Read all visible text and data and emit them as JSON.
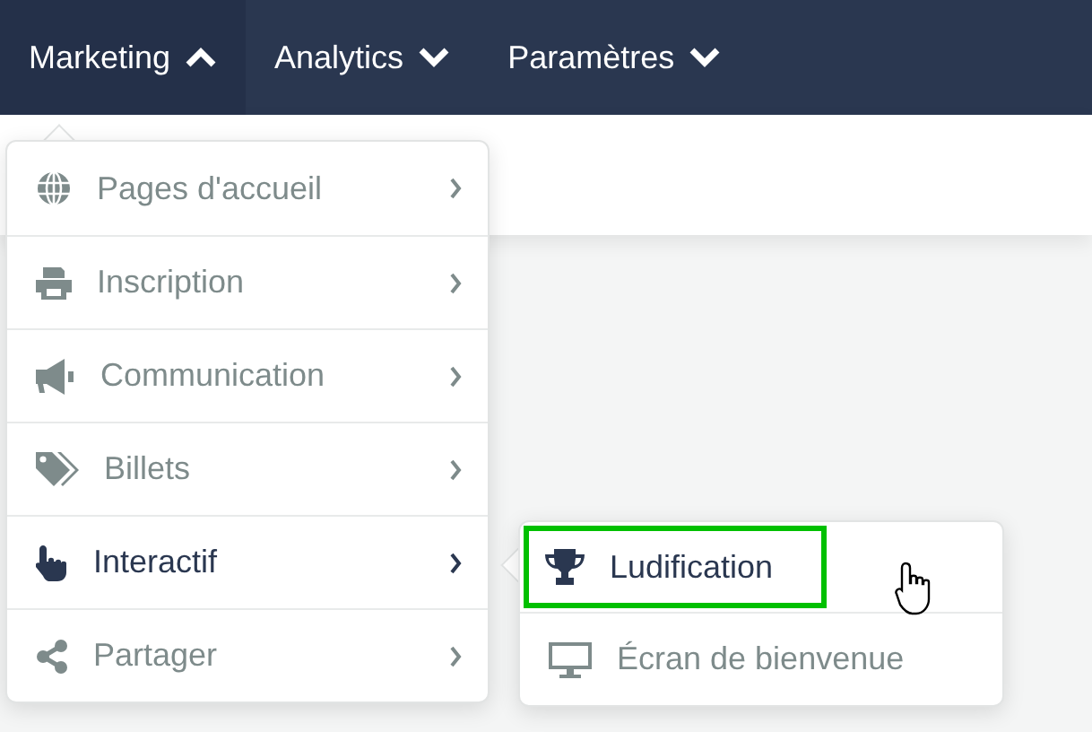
{
  "navbar": {
    "items": [
      {
        "label": "Marketing",
        "expanded": true
      },
      {
        "label": "Analytics",
        "expanded": false
      },
      {
        "label": "Paramètres",
        "expanded": false
      }
    ]
  },
  "menu": {
    "items": [
      {
        "label": "Pages d'accueil",
        "selected": false
      },
      {
        "label": "Inscription",
        "selected": false
      },
      {
        "label": "Communication",
        "selected": false
      },
      {
        "label": "Billets",
        "selected": false
      },
      {
        "label": "Interactif",
        "selected": true
      },
      {
        "label": "Partager",
        "selected": false
      }
    ]
  },
  "submenu": {
    "items": [
      {
        "label": "Ludification",
        "selected": true,
        "highlighted": true
      },
      {
        "label": "Écran de bienvenue",
        "selected": false,
        "highlighted": false
      }
    ]
  }
}
